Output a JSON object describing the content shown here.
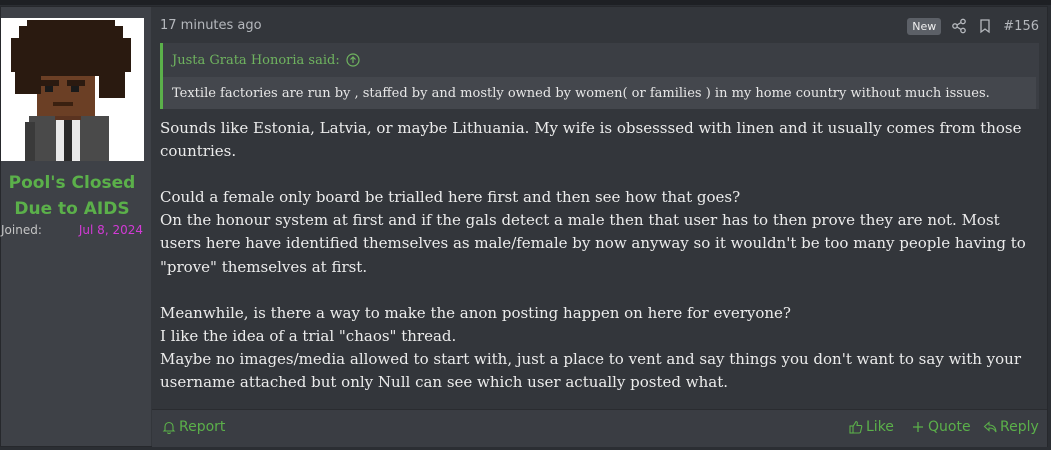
{
  "user": {
    "username_line1": "Pool's Closed",
    "username_line2": "Due to AIDS",
    "joined_label": "Joined:",
    "joined_date": "Jul 8, 2024"
  },
  "post": {
    "time": "17 minutes ago",
    "badge": "New",
    "number": "#156",
    "quote": {
      "author": "Justa Grata Honoria said:",
      "text": "Textile factories are run by , staffed by and mostly owned by women( or families ) in my home country without much issues."
    },
    "message": {
      "p1": "Sounds like Estonia, Latvia, or maybe Lithuania. My wife is obsesssed with linen and it usually comes from those countries.",
      "p2a": "Could a female only board be trialled here first and then see how that goes?",
      "p2b": "On the honour system at first and if the gals detect a male then that user has to then prove they are not. Most users here have identified themselves as male/female by now anyway so it wouldn't be too many people having to \"prove\" themselves at first.",
      "p3a": "Meanwhile, is there a way to make the anon posting happen on here for everyone?",
      "p3b": "I like the idea of a trial \"chaos\" thread.",
      "p3c": "Maybe no images/media allowed to start with, just a place to vent and say things you don't want to say with your username attached but only Null can see which user actually posted what."
    }
  },
  "footer": {
    "report": "Report",
    "like": "Like",
    "quote": "Quote",
    "reply": "Reply"
  },
  "colors": {
    "accent": "#5bb04a",
    "date": "#d23ad6",
    "background": "#33363b"
  },
  "icons": [
    "share-icon",
    "bookmark-icon",
    "up-arrow-icon",
    "bell-icon",
    "thumb-up-icon",
    "plus-icon",
    "reply-icon"
  ]
}
